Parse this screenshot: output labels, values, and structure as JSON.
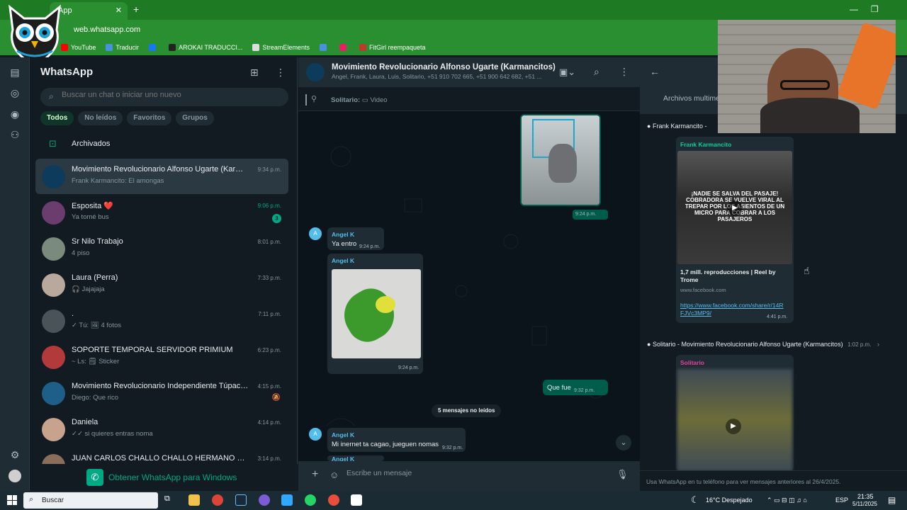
{
  "browser": {
    "tab_title": "App",
    "url": "web.whatsapp.com",
    "bookmarks": [
      {
        "label": "YouTube",
        "color": "#ff0000"
      },
      {
        "label": "Traducir",
        "color": "#4a90e2"
      },
      {
        "label": "",
        "color": "#1877f2"
      },
      {
        "label": "AROKAI TRADUCCI...",
        "color": "#222222"
      },
      {
        "label": "StreamElements",
        "color": "#dddddd"
      },
      {
        "label": "",
        "color": "#4a90e2"
      },
      {
        "label": "",
        "color": "#e91e63"
      },
      {
        "label": "FitGirl reempaqueta",
        "color": "#c0392b"
      }
    ]
  },
  "chatlist": {
    "title": "WhatsApp",
    "search_placeholder": "Buscar un chat o iniciar uno nuevo",
    "filters": [
      "Todos",
      "No leídos",
      "Favoritos",
      "Grupos"
    ],
    "archived_label": "Archivados",
    "chats": [
      {
        "name": "Movimiento Revolucionario Alfonso Ugarte (Karmanc...",
        "message": "Frank Karmancito: El amongas",
        "time": "9:34 p.m.",
        "selected": true
      },
      {
        "name": "Esposita ❤️",
        "message": "Ya tomé bus",
        "time": "9:06 p.m.",
        "badge": "3",
        "time_green": true
      },
      {
        "name": "Sr Nilo Trabajo",
        "message": "4 piso",
        "time": "8:01 p.m."
      },
      {
        "name": "Laura (Perra)",
        "message": "🎧 Jajajaja",
        "time": "7:33 p.m."
      },
      {
        "name": ".",
        "message": "✓ Tú: 🖼 4 fotos",
        "time": "7:11 p.m."
      },
      {
        "name": "SOPORTE TEMPORAL SERVIDOR PRIMIUM",
        "message": "~ Ls: 🗒 Sticker",
        "time": "6:23 p.m."
      },
      {
        "name": "Movimiento Revolucionario Independiente Túpac Am...",
        "message": "Diego: Que rico",
        "time": "4:15 p.m.",
        "muted": true
      },
      {
        "name": "Daniela",
        "message": "✓✓ si quieres entras noma",
        "time": "4:14 p.m."
      },
      {
        "name": "JUAN CARLOS CHALLO CHALLO HERMANO DE YANE...",
        "message": "",
        "time": "3:14 p.m."
      }
    ],
    "get_windows_label": "Obtener WhatsApp para Windows"
  },
  "conversation": {
    "title": "Movimiento Revolucionario Alfonso Ugarte (Karmancitos)",
    "participants": "Angel, Frank, Laura, Luis, Solitario, +51 910 702 665, +51 900 642 682, +51 ...",
    "pinned_sender": "Solitario:",
    "pinned_content": "Video",
    "messages": {
      "img1_time": "9:24 p.m.",
      "m1_sender": "Angel K",
      "m1_text": "Ya entro",
      "m1_time": "9:24 p.m.",
      "m2_sender": "Angel K",
      "m2_time": "9:24 p.m.",
      "m3_text": "Que fue",
      "m3_time": "9:32 p.m.",
      "unread_label": "5 mensajes no leídos",
      "m4_sender": "Angel K",
      "m4_text": "Mi inernet ta cagao, jueguen nomas",
      "m4_time": "9:32 p.m.",
      "m5_sender": "Angel K"
    },
    "avatar_letter": "A",
    "composer_placeholder": "Escribe un mensaje"
  },
  "media_panel": {
    "tab_label": "Archivos multime",
    "item1": {
      "header": "Frank Karmancito -",
      "sender": "Frank Karmancito",
      "thumb_text": "¡NADIE SE SALVA DEL PASAJE! COBRADORA SE VUELVE VIRAL AL TREPAR POR LOS ASIENTOS DE UN MICRO PARA COBRAR A LOS PASAJEROS",
      "title": "1,7 mill. reproducciones | Reel by Trome",
      "domain": "www.facebook.com",
      "link": "https://www.facebook.com/share/r/14RFJVc3MP9/",
      "time": "4:41 p.m."
    },
    "item2": {
      "header": "Solitario - Movimiento Revolucionario Alfonso Ugarte (Karmancitos)",
      "time": "1:02 p.m.",
      "sender": "Solitario"
    },
    "footer": "Usa WhatsApp en tu teléfono para ver mensajes anteriores al 26/4/2025."
  },
  "taskbar": {
    "search_label": "Buscar",
    "weather": "16°C  Despejado",
    "lang": "ESP",
    "time": "21:35",
    "date": "5/11/2025"
  },
  "colors": {
    "accent": "#00a884",
    "outgoing": "#005c4b",
    "incoming": "#202c33",
    "browser_green": "#2a8f30"
  }
}
